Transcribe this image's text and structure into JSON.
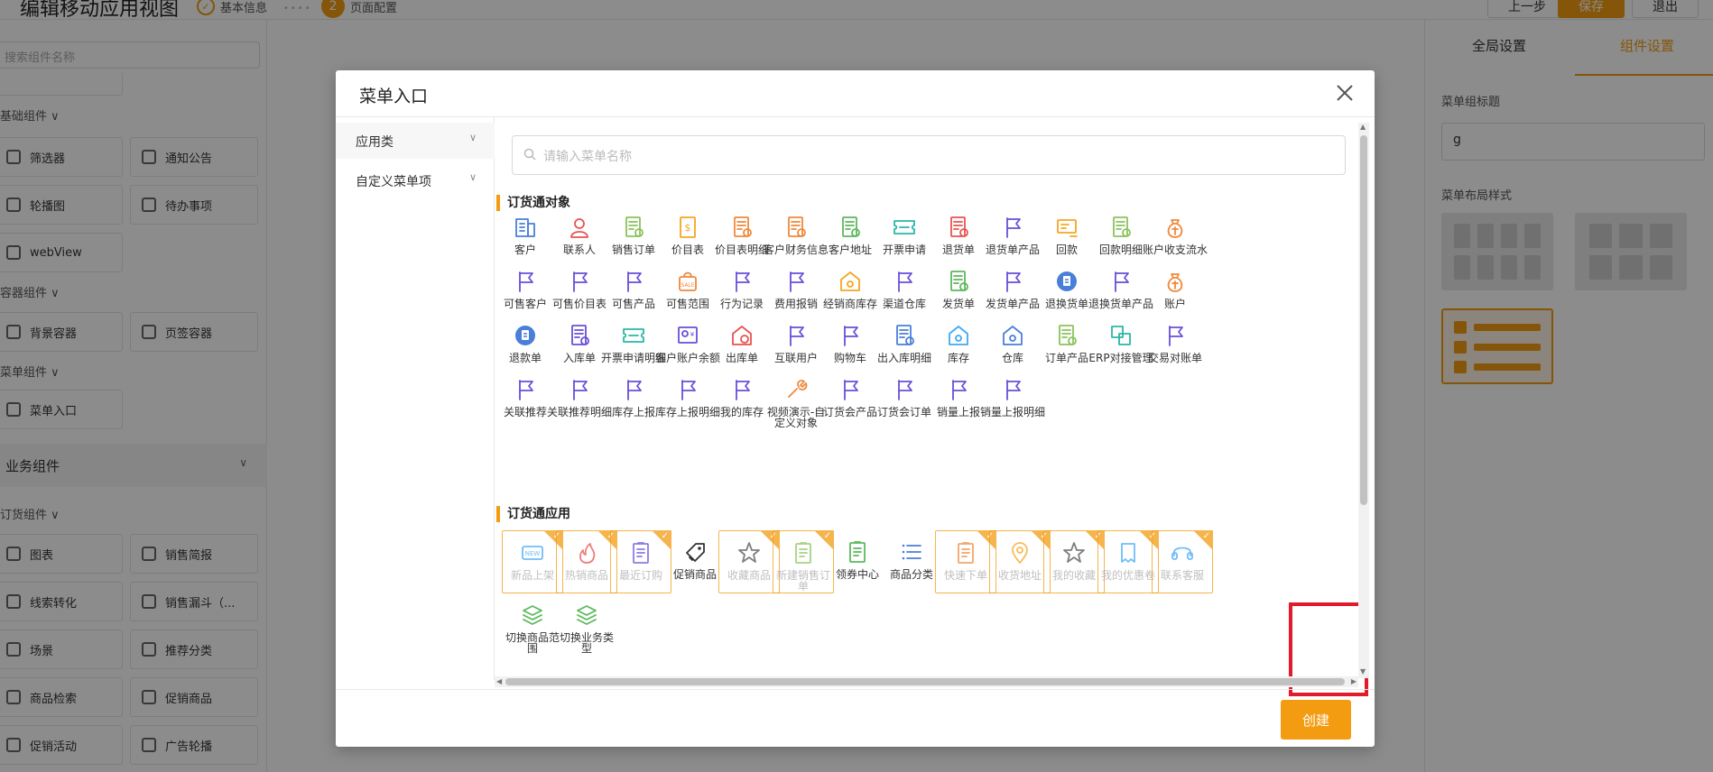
{
  "colors": {
    "accent": "#f39c12",
    "highlight": "#e21a2c"
  },
  "app": {
    "title": "编辑移动应用视图",
    "steps": [
      {
        "label": "基本信息"
      },
      {
        "num": "2",
        "label": "页面配置"
      }
    ],
    "buttons": {
      "prev": "上一步",
      "save": "保存",
      "exit": "退出"
    }
  },
  "left": {
    "search_placeholder": "搜索组件名称",
    "groups": {
      "basic": "基础组件",
      "container": "容器组件",
      "menu": "菜单组件",
      "business": "业务组件",
      "order": "订货组件"
    },
    "components": {
      "filter": "筛选器",
      "notice": "通知公告",
      "carousel": "轮播图",
      "todo": "待办事项",
      "webview": "webView",
      "bg_container": "背景容器",
      "tab_container": "页签容器",
      "menu_entry": "菜单入口",
      "chart": "图表",
      "sales_brief": "销售简报",
      "lead_convert": "线索转化",
      "sales_funnel": "销售漏斗（...",
      "scene": "场景",
      "recommend": "推荐分类",
      "product_search": "商品检索",
      "promo_product": "促销商品",
      "promo_activity": "促销活动",
      "ad_carousel": "广告轮播"
    }
  },
  "right": {
    "tabs": {
      "global": "全局设置",
      "component": "组件设置"
    },
    "menu_group_title_label": "菜单组标题",
    "menu_group_title_value": "g",
    "layout_style_label": "菜单布局样式"
  },
  "modal": {
    "title": "菜单入口",
    "categories": [
      "应用类",
      "自定义菜单项"
    ],
    "search_placeholder": "请输入菜单名称",
    "section_objects": "订货通对象",
    "section_apps": "订货通应用",
    "objects": [
      {
        "label": "客户",
        "icon": "customer-icon",
        "color": "#4a7fd8"
      },
      {
        "label": "联系人",
        "icon": "contact-icon",
        "color": "#e8534f"
      },
      {
        "label": "销售订单",
        "icon": "sales-order-icon",
        "color": "#8ac35a"
      },
      {
        "label": "价目表",
        "icon": "price-list-icon",
        "color": "#f5a623"
      },
      {
        "label": "价目表明细",
        "icon": "price-detail-icon",
        "color": "#f0883a"
      },
      {
        "label": "客户财务信息",
        "icon": "finance-icon",
        "color": "#f0883a"
      },
      {
        "label": "客户地址",
        "icon": "address-icon",
        "color": "#5cb85c"
      },
      {
        "label": "开票申请",
        "icon": "invoice-icon",
        "color": "#28b7a7"
      },
      {
        "label": "退货单",
        "icon": "return-icon",
        "color": "#e8534f"
      },
      {
        "label": "退货单产品",
        "icon": "flag-icon",
        "color": "#6a4fd8"
      },
      {
        "label": "回款",
        "icon": "payment-icon",
        "color": "#f5a623"
      },
      {
        "label": "回款明细",
        "icon": "payment-detail-icon",
        "color": "#8ac35a"
      },
      {
        "label": "账户收支流水",
        "icon": "money-bag-icon",
        "color": "#f0883a"
      },
      {
        "label": "可售客户",
        "icon": "flag-icon",
        "color": "#6a4fd8"
      },
      {
        "label": "可售价目表",
        "icon": "flag-icon",
        "color": "#6a4fd8"
      },
      {
        "label": "可售产品",
        "icon": "flag-icon",
        "color": "#6a4fd8"
      },
      {
        "label": "可售范围",
        "icon": "sale-bag-icon",
        "color": "#f0883a"
      },
      {
        "label": "行为记录",
        "icon": "flag-icon",
        "color": "#6a4fd8"
      },
      {
        "label": "费用报销",
        "icon": "flag-icon",
        "color": "#6a4fd8"
      },
      {
        "label": "经销商库存",
        "icon": "warehouse-icon",
        "color": "#f5a623"
      },
      {
        "label": "渠道仓库",
        "icon": "flag-icon",
        "color": "#6a4fd8"
      },
      {
        "label": "发货单",
        "icon": "delivery-icon",
        "color": "#5cb85c"
      },
      {
        "label": "发货单产品",
        "icon": "flag-icon",
        "color": "#6a4fd8"
      },
      {
        "label": "退换货单",
        "icon": "exchange-icon",
        "color": "#4a7fd8"
      },
      {
        "label": "退换货单产品",
        "icon": "flag-icon",
        "color": "#6a4fd8"
      },
      {
        "label": "账户",
        "icon": "money-bag-icon",
        "color": "#f0883a"
      },
      {
        "label": "退款单",
        "icon": "refund-icon",
        "color": "#4a7fd8"
      },
      {
        "label": "入库单",
        "icon": "inbound-icon",
        "color": "#6a4fd8"
      },
      {
        "label": "开票申请明细",
        "icon": "invoice-icon",
        "color": "#28b7a7"
      },
      {
        "label": "客户账户余额",
        "icon": "balance-icon",
        "color": "#6a4fd8"
      },
      {
        "label": "出库单",
        "icon": "outbound-icon",
        "color": "#e8534f"
      },
      {
        "label": "互联用户",
        "icon": "flag-icon",
        "color": "#6a4fd8"
      },
      {
        "label": "购物车",
        "icon": "flag-icon",
        "color": "#6a4fd8"
      },
      {
        "label": "出入库明细",
        "icon": "io-detail-icon",
        "color": "#4a7fd8"
      },
      {
        "label": "库存",
        "icon": "stock-icon",
        "color": "#3fa9f5"
      },
      {
        "label": "仓库",
        "icon": "warehouse-home-icon",
        "color": "#4a7fd8"
      },
      {
        "label": "订单产品",
        "icon": "order-product-icon",
        "color": "#8ac35a"
      },
      {
        "label": "ERP对接管理",
        "icon": "erp-icon",
        "color": "#28b7a7"
      },
      {
        "label": "交易对账单",
        "icon": "flag-icon",
        "color": "#6a4fd8"
      },
      {
        "label": "关联推荐",
        "icon": "flag-icon",
        "color": "#6a4fd8"
      },
      {
        "label": "关联推荐明细",
        "icon": "flag-icon",
        "color": "#6a4fd8"
      },
      {
        "label": "库存上报",
        "icon": "flag-icon",
        "color": "#6a4fd8"
      },
      {
        "label": "库存上报明细",
        "icon": "flag-icon",
        "color": "#6a4fd8"
      },
      {
        "label": "我的库存",
        "icon": "flag-icon",
        "color": "#6a4fd8"
      },
      {
        "label": "视频演示-自定义对象",
        "icon": "wrench-icon",
        "color": "#f0883a"
      },
      {
        "label": "订货会产品",
        "icon": "flag-icon",
        "color": "#6a4fd8"
      },
      {
        "label": "订货会订单",
        "icon": "flag-icon",
        "color": "#6a4fd8"
      },
      {
        "label": "销量上报",
        "icon": "flag-icon",
        "color": "#6a4fd8"
      },
      {
        "label": "销量上报明细",
        "icon": "flag-icon",
        "color": "#6a4fd8"
      }
    ],
    "apps": [
      {
        "label": "新品上架",
        "icon": "new-icon",
        "color": "#3fa9f5",
        "selected": true
      },
      {
        "label": "热销商品",
        "icon": "fire-icon",
        "color": "#e8534f",
        "selected": true
      },
      {
        "label": "最近订购",
        "icon": "recent-order-icon",
        "color": "#6a4fd8",
        "selected": true
      },
      {
        "label": "促销商品",
        "icon": "tag-icon",
        "color": "#333333",
        "selected": false
      },
      {
        "label": "收藏商品",
        "icon": "star-icon",
        "color": "#555555",
        "selected": true
      },
      {
        "label": "新建销售订单",
        "icon": "new-order-icon",
        "color": "#8ac35a",
        "selected": true
      },
      {
        "label": "领券中心",
        "icon": "coupon-icon",
        "color": "#5cb85c",
        "selected": false
      },
      {
        "label": "商品分类",
        "icon": "list-icon",
        "color": "#4a7fd8",
        "selected": false
      },
      {
        "label": "快速下单",
        "icon": "quick-order-icon",
        "color": "#f0883a",
        "selected": true
      },
      {
        "label": "收货地址",
        "icon": "location-icon",
        "color": "#f5a623",
        "selected": true
      },
      {
        "label": "我的收藏",
        "icon": "star-icon",
        "color": "#555555",
        "selected": true
      },
      {
        "label": "我的优惠卷",
        "icon": "voucher-icon",
        "color": "#3fa9f5",
        "selected": true
      },
      {
        "label": "联系客服",
        "icon": "headset-icon",
        "color": "#3fa9f5",
        "selected": true
      },
      {
        "label": "切换商品范围",
        "icon": "layers-icon",
        "color": "#5cb85c",
        "selected": false
      },
      {
        "label": "切换业务类型",
        "icon": "layers-icon",
        "color": "#5cb85c",
        "selected": false
      }
    ],
    "create_button": "创建"
  }
}
